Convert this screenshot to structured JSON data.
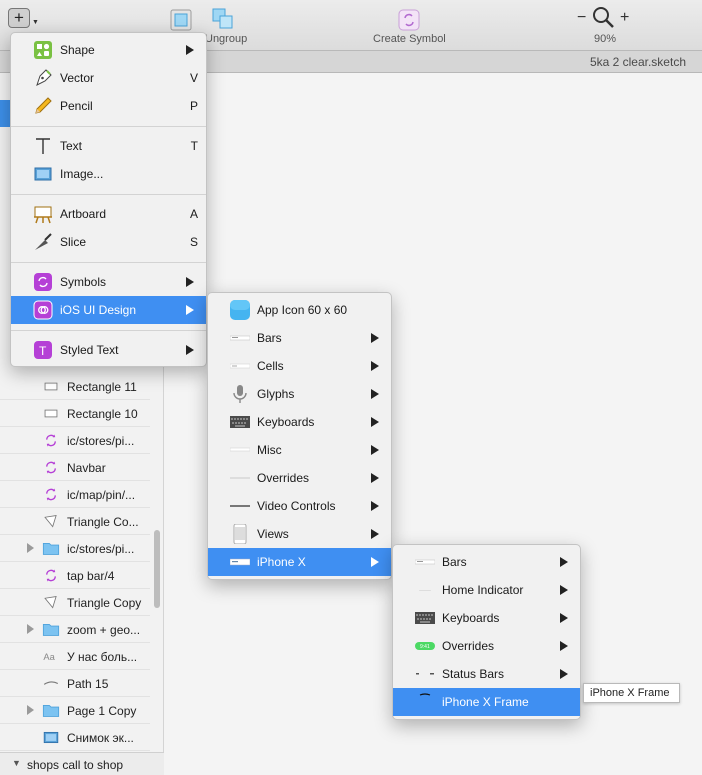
{
  "toolbar": {
    "ungroup_label": "Ungroup",
    "create_symbol_label": "Create Symbol",
    "zoom_minus": "−",
    "zoom_plus": "+",
    "zoom_value": "90%"
  },
  "document": {
    "title": "5ka 2 clear.sketch"
  },
  "layers": {
    "rows": [
      {
        "name": "Rectangle 11",
        "icon": "rectangle-icon"
      },
      {
        "name": "Rectangle 10",
        "icon": "rectangle-icon"
      },
      {
        "name": "ic/stores/pi...",
        "icon": "symbol-icon"
      },
      {
        "name": "Navbar",
        "icon": "symbol-icon"
      },
      {
        "name": "ic/map/pin/...",
        "icon": "symbol-icon"
      },
      {
        "name": "Triangle Co...",
        "icon": "triangle-icon"
      },
      {
        "name": "ic/stores/pi...",
        "icon": "folder-icon"
      },
      {
        "name": "tap bar/4",
        "icon": "symbol-icon"
      },
      {
        "name": "Triangle Copy",
        "icon": "triangle-icon"
      },
      {
        "name": "zoom + geo...",
        "icon": "folder-icon"
      },
      {
        "name": "У нас боль...",
        "icon": "text-icon",
        "glyph": "Aa"
      },
      {
        "name": "Path 15",
        "icon": "path-icon"
      },
      {
        "name": "Page 1 Copy",
        "icon": "folder-icon"
      },
      {
        "name": "Снимок эк...",
        "icon": "image-icon"
      }
    ],
    "footer": "shops call to shop"
  },
  "menu1": {
    "items": [
      {
        "label": "Shape",
        "key": "",
        "submenu": true,
        "icon": "shape-icon"
      },
      {
        "label": "Vector",
        "key": "V",
        "submenu": false,
        "icon": "vector-pen-icon"
      },
      {
        "label": "Pencil",
        "key": "P",
        "submenu": false,
        "icon": "pencil-icon"
      },
      {
        "label": "Text",
        "key": "T",
        "submenu": false,
        "icon": "text-tool-icon"
      },
      {
        "label": "Image...",
        "key": "",
        "submenu": false,
        "icon": "image-icon"
      },
      {
        "label": "Artboard",
        "key": "A",
        "submenu": false,
        "icon": "artboard-icon"
      },
      {
        "label": "Slice",
        "key": "S",
        "submenu": false,
        "icon": "slice-knife-icon"
      },
      {
        "label": "Symbols",
        "key": "",
        "submenu": true,
        "icon": "symbols-icon"
      },
      {
        "label": "iOS UI Design",
        "key": "",
        "submenu": true,
        "icon": "ios-ui-design-icon"
      },
      {
        "label": "Styled Text",
        "key": "",
        "submenu": true,
        "icon": "styled-text-icon",
        "glyph": "T"
      }
    ]
  },
  "menu2": {
    "items": [
      {
        "label": "App Icon 60 x 60",
        "submenu": false,
        "icon": "app-icon-thumbnail"
      },
      {
        "label": "Bars",
        "submenu": true,
        "icon": "bars-thumbnail-icon"
      },
      {
        "label": "Cells",
        "submenu": true,
        "icon": "cells-thumbnail-icon"
      },
      {
        "label": "Glyphs",
        "submenu": true,
        "icon": "microphone-icon"
      },
      {
        "label": "Keyboards",
        "submenu": true,
        "icon": "keyboard-thumbnail-icon"
      },
      {
        "label": "Misc",
        "submenu": true,
        "icon": "misc-thumbnail-icon"
      },
      {
        "label": "Overrides",
        "submenu": true,
        "icon": "overrides-thumbnail-icon"
      },
      {
        "label": "Video Controls",
        "submenu": true,
        "icon": "video-controls-icon"
      },
      {
        "label": "Views",
        "submenu": true,
        "icon": "phone-view-icon"
      },
      {
        "label": "iPhone X",
        "submenu": true,
        "icon": "iphone-x-thumbnail-icon"
      }
    ]
  },
  "menu3": {
    "items": [
      {
        "label": "Bars",
        "submenu": true,
        "icon": "bars-thumbnail-icon"
      },
      {
        "label": "Home Indicator",
        "submenu": true,
        "icon": "home-indicator-icon"
      },
      {
        "label": "Keyboards",
        "submenu": true,
        "icon": "keyboard-thumbnail-icon"
      },
      {
        "label": "Overrides",
        "submenu": true,
        "icon": "overrides-badge-icon",
        "badge": "9:41"
      },
      {
        "label": "Status Bars",
        "submenu": true,
        "icon": "status-bar-icon"
      },
      {
        "label": "iPhone X Frame",
        "submenu": false,
        "icon": "iphone-x-frame-icon"
      }
    ]
  },
  "tooltip": {
    "text": "iPhone X Frame"
  },
  "colors": {
    "selection": "#3f8ff2",
    "symbol_purple": "#b540d6",
    "shape_green": "#7ac143",
    "folder_blue": "#7cc3f1"
  }
}
